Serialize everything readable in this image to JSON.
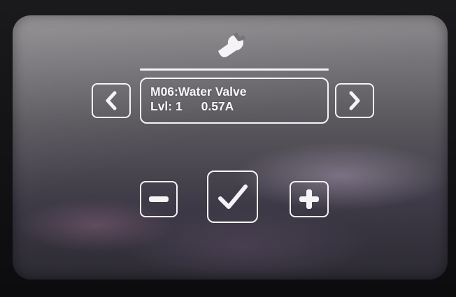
{
  "header": {
    "icon": "wrench-icon"
  },
  "module_panel": {
    "module_name": "M06:Water Valve",
    "level_text": "Lvl: 1",
    "current_text": "0.57A"
  },
  "navigation": {
    "prev_icon": "chevron-left-icon",
    "next_icon": "chevron-right-icon"
  },
  "controls": {
    "decrease_icon": "minus-icon",
    "confirm_icon": "checkmark-icon",
    "increase_icon": "plus-icon"
  },
  "colors": {
    "ui_stroke": "#f4f4f6",
    "screen_top": "#8b898c",
    "screen_bottom": "#2c2a33"
  }
}
